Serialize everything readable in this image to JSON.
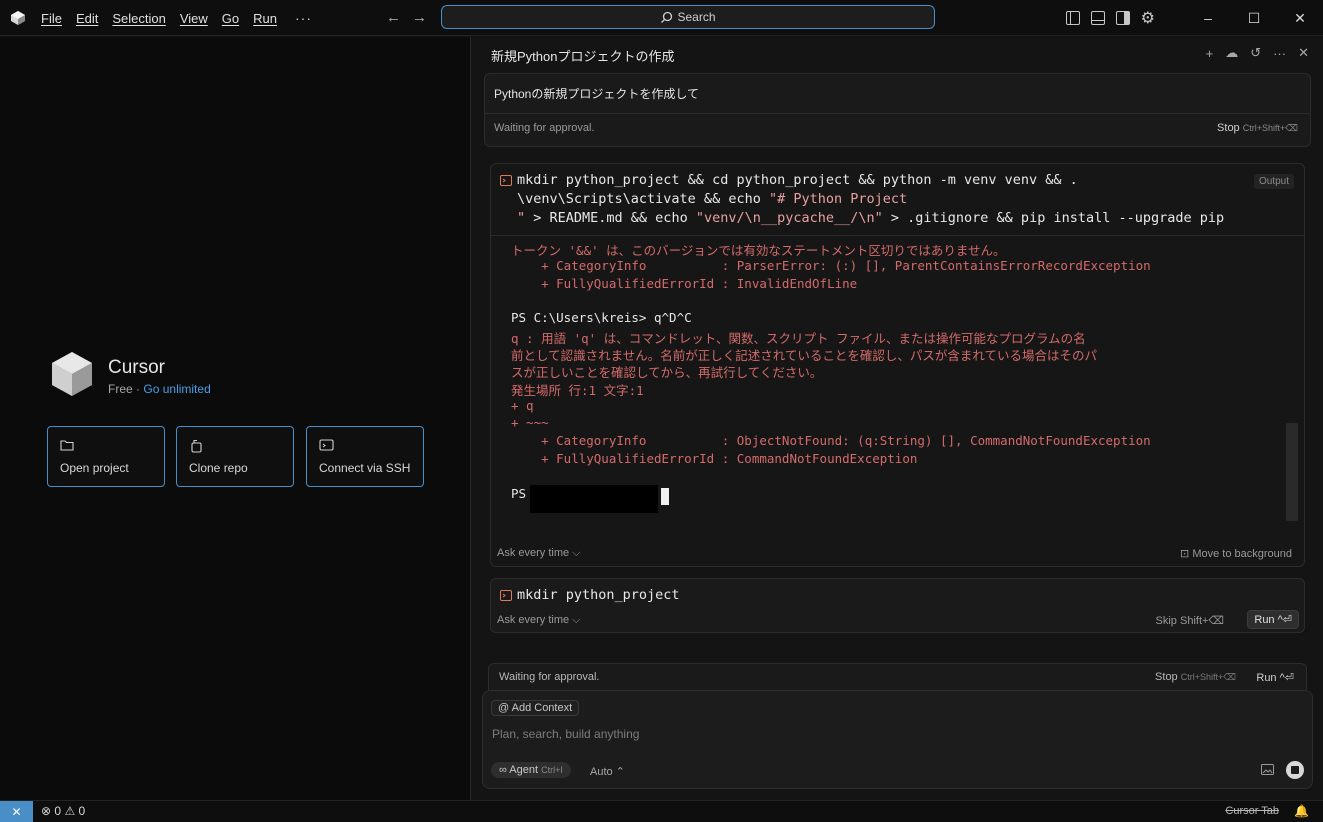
{
  "titlebar": {
    "menu": [
      "File",
      "Edit",
      "Selection",
      "View",
      "Go",
      "Run"
    ],
    "more": "···",
    "search_label": "Search",
    "icons": [
      "toggle-primary-sidebar-icon",
      "toggle-panel-icon",
      "toggle-secondary-sidebar-icon",
      "settings-gear-icon"
    ],
    "window_controls": [
      "–",
      "☐",
      "✕"
    ]
  },
  "welcome": {
    "brand": "Cursor",
    "plan": "Free",
    "separator": "·",
    "upgrade_link": "Go unlimited",
    "actions": [
      {
        "label": "Open project",
        "icon": "folder-icon"
      },
      {
        "label": "Clone repo",
        "icon": "clone-icon"
      },
      {
        "label": "Connect via SSH",
        "icon": "terminal-window-icon"
      }
    ]
  },
  "chat": {
    "title": "新規Pythonプロジェクトの作成",
    "header_icons": [
      "+",
      "☁",
      "↺",
      "···",
      "✕"
    ],
    "user_message": "Pythonの新規プロジェクトを作成して",
    "waiting": "Waiting for approval.",
    "stop_label": "Stop",
    "stop_shortcut": "Ctrl+Shift+⌫",
    "terminal": {
      "cmd_l1": "mkdir python_project && cd python_project && python -m venv venv && .",
      "cmd_l2a": "\\venv\\Scripts\\activate && echo ",
      "cmd_l2b": "\"# Python Project",
      "cmd_l3a": "\"",
      "cmd_l3b": " > README.md && echo ",
      "cmd_l3c": "\"venv/\\n__pycache__/\\n\"",
      "cmd_l3d": " > .gitignore && pip install --upgrade pip",
      "output_tag": "Output",
      "lines": [
        "トークン '&&' は、このバージョンでは有効なステートメント区切りではありません。",
        "    + CategoryInfo          : ParserError: (:) [], ParentContainsErrorRecordException",
        "    + FullyQualifiedErrorId : InvalidEndOfLine",
        "PS C:\\Users\\kreis> q^D^C",
        "q : 用語 'q' は、コマンドレット、関数、スクリプト ファイル、または操作可能なプログラムの名",
        "前として認識されません。名前が正しく記述されていることを確認し、パスが含まれている場合はそのパ",
        "スが正しいことを確認してから、再試行してください。",
        "発生場所 行:1 文字:1",
        "+ q",
        "+ ~~~",
        "    + CategoryInfo          : ObjectNotFound: (q:String) [], CommandNotFoundException",
        "    + FullyQualifiedErrorId : CommandNotFoundException",
        "PS"
      ],
      "ask_every_time": "Ask every time ⌵",
      "move_to_background": "⊡ Move to background"
    },
    "pending_command": {
      "command": "mkdir python_project",
      "ask_every_time": "Ask every time ⌵",
      "skip_label": "Skip",
      "skip_shortcut": "Shift+⌫",
      "run_label": "Run ^⏎"
    },
    "bottom_bar": {
      "waiting": "Waiting for approval.",
      "stop_label": "Stop",
      "stop_shortcut": "Ctrl+Shift+⌫",
      "run_label": "Run ^⏎"
    },
    "composer": {
      "add_context": "@ Add Context",
      "placeholder": "Plan, search, build anything",
      "agent_label": "∞ Agent",
      "agent_shortcut": "Ctrl+I",
      "auto_label": "Auto ⌃"
    }
  },
  "statusbar": {
    "remote": "✕",
    "errors": "0",
    "warnings": "0",
    "cursor_tab": "Cursor Tab",
    "bell": "🔔"
  },
  "colors": {
    "accent": "#4a8ec8",
    "error_text": "#d46a6a",
    "link": "#4a9ee8"
  }
}
